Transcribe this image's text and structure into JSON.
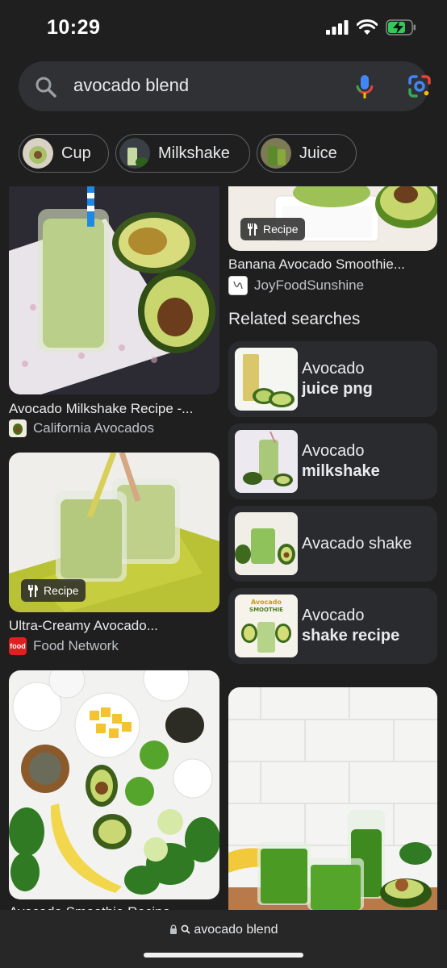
{
  "status": {
    "time": "10:29"
  },
  "search": {
    "query": "avocado blend"
  },
  "chips": [
    {
      "label": "Cup"
    },
    {
      "label": "Milkshake"
    },
    {
      "label": "Juice"
    }
  ],
  "results": {
    "r1": {
      "title": "Avocado Milkshake Recipe -...",
      "source": "California Avocados"
    },
    "r2": {
      "title": "Banana Avocado Smoothie...",
      "source": "JoyFoodSunshine",
      "badge": "Recipe"
    },
    "r3": {
      "title": "Ultra-Creamy Avocado...",
      "source": "Food Network",
      "badge": "Recipe"
    },
    "r4": {
      "title": "Avocado Smoothie Recipe"
    }
  },
  "related": {
    "heading": "Related searches",
    "items": [
      {
        "plain": "Avocado",
        "bold": "juice png"
      },
      {
        "plain": "Avocado",
        "bold": "milkshake"
      },
      {
        "plain": "Avacado shake",
        "bold": ""
      },
      {
        "plain": "Avocado",
        "bold": "shake recipe"
      }
    ],
    "thumb_text": "Avocado SMOOTHIE"
  },
  "bottom": {
    "url": "avocado blend"
  },
  "colors": {
    "background": "#1f1f1f",
    "surface": "#303134",
    "card": "#2a2b2e",
    "avocado_green": "#b5cf8c"
  }
}
